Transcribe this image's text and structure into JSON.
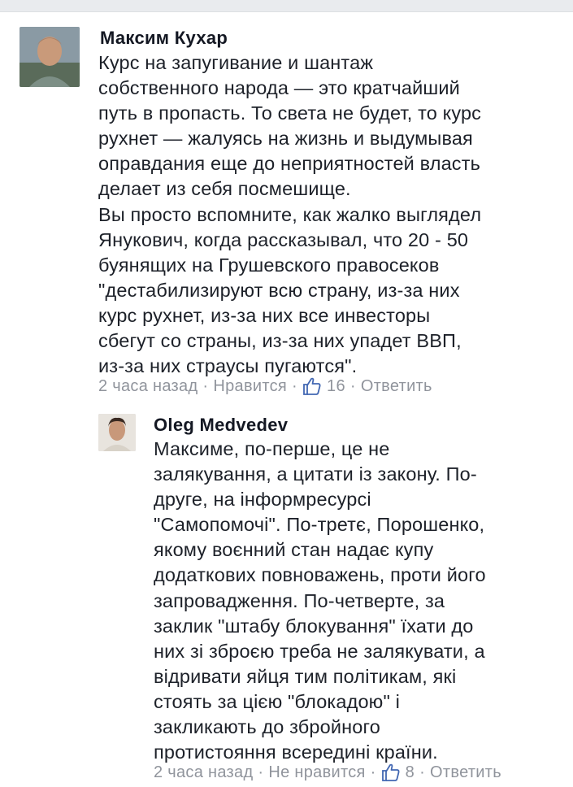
{
  "comments": [
    {
      "author": "Максим Кухар",
      "text": "Курс на запугивание и шантаж\nсобственного народа — это кратчайший\nпуть в пропасть. То света не будет, то курс\nрухнет — жалуясь на жизнь и выдумывая\nоправдания еще до неприятностей власть\nделает из себя посмешище.\nВы просто вспомните, как жалко выглядел\nЯнукович, когда рассказывал, что 20 - 50\nбуянящих на Грушевского правосеков\n\"дестабилизируют всю страну, из-за них\nкурс рухнет, из-за них все инвесторы\nсбегут со страны, из-за них упадет ВВП,\nиз-за них страусы пугаются\".",
      "time": "2 часа назад",
      "like_label": "Нравится",
      "like_count": "16",
      "reply_label": "Ответить",
      "separator": "·",
      "avatar_icon": "user-photo"
    },
    {
      "author": "Oleg Medvedev",
      "text": "Максиме, по-перше, це не\nзалякування, а цитати із закону. По-\nдруге, на інформресурсі\n\"Самопомочі\". По-третє, Порошенко,\nякому воєнний стан надає купу\nдодаткових повноважень, проти його\nзапровадження. По-четверте, за\nзаклик \"штабу блокування\" їхати до\nних зі зброєю треба не залякувати, а\nвідривати яйця тим політикам, які\nстоять за цією \"блокадою\" і\nзакликають до збройного\nпротистояння всередині країни.",
      "time": "2 часа назад",
      "like_label": "Не нравится",
      "like_count": "8",
      "reply_label": "Ответить",
      "separator": "·",
      "avatar_icon": "user-photo"
    }
  ],
  "colors": {
    "text": "#1d2129",
    "meta": "#90949c",
    "like_blue": "#4267b2"
  }
}
